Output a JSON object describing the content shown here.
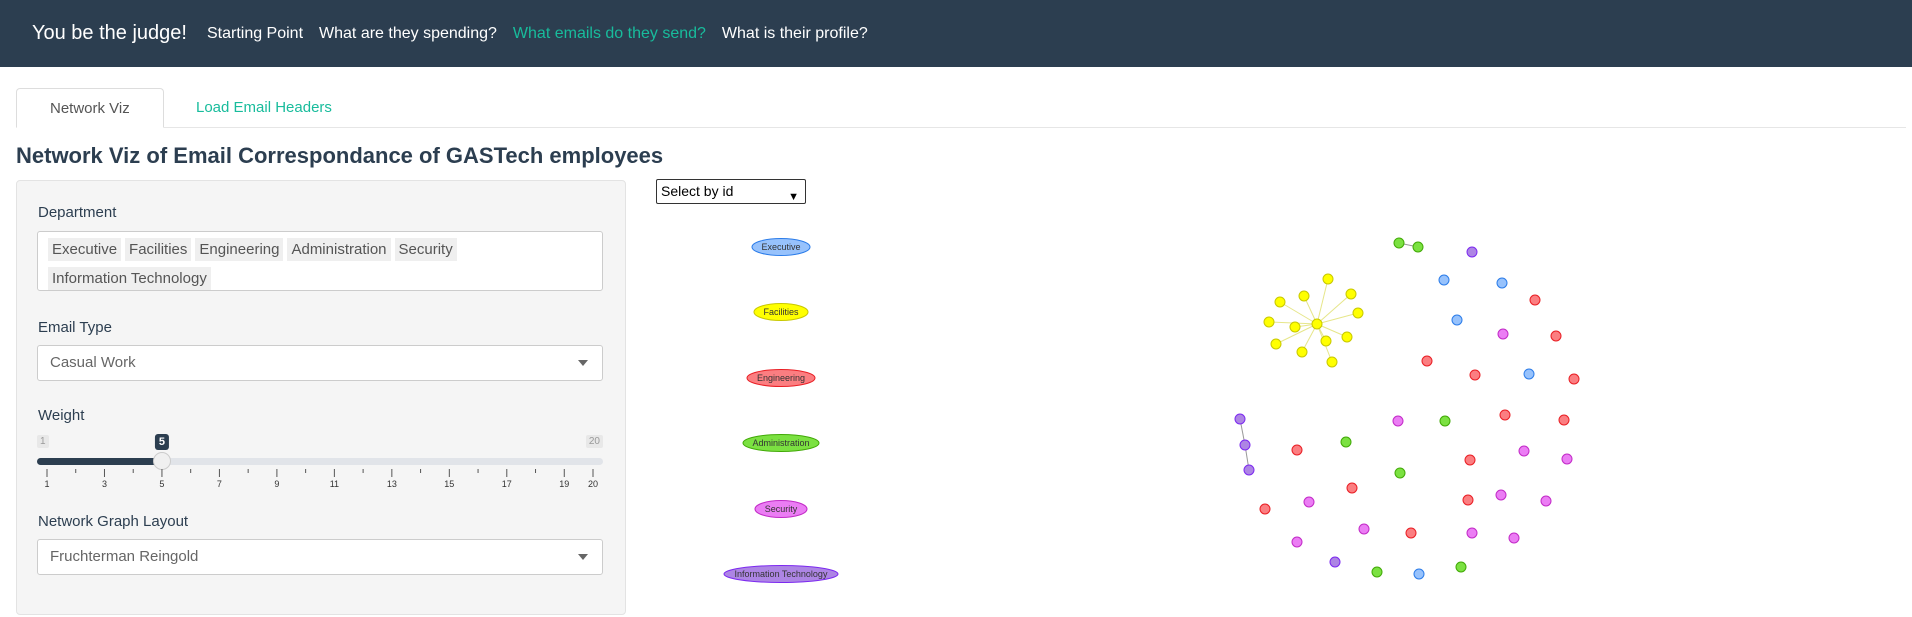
{
  "navbar": {
    "brand": "You be the judge!",
    "items": [
      {
        "label": "Starting Point",
        "active": false
      },
      {
        "label": "What are they spending?",
        "active": false
      },
      {
        "label": "What emails do they send?",
        "active": true
      },
      {
        "label": "What is their profile?",
        "active": false
      }
    ]
  },
  "tabs": [
    "Network Viz",
    "Load Email Headers"
  ],
  "page_title": "Network Viz of Email Correspondance of GASTech employees",
  "filters": {
    "department_label": "Department",
    "departments": [
      "Executive",
      "Facilities",
      "Engineering",
      "Administration",
      "Security",
      "Information Technology"
    ],
    "email_type_label": "Email Type",
    "email_type_value": "Casual Work",
    "weight_label": "Weight",
    "weight_min": "1",
    "weight_max": "20",
    "weight_value": "5",
    "weight_ticks": [
      "1",
      "3",
      "5",
      "7",
      "9",
      "11",
      "13",
      "15",
      "17",
      "19",
      "20"
    ],
    "layout_label": "Network Graph Layout",
    "layout_value": "Fruchterman Reingold"
  },
  "id_select": "Select by id",
  "legend": [
    {
      "label": "Executive",
      "color": "#97c2fc",
      "border": "#2b7ce9"
    },
    {
      "label": "Facilities",
      "color": "#ffff00",
      "border": "#c8c800"
    },
    {
      "label": "Engineering",
      "color": "#fb7e81",
      "border": "#e91e24"
    },
    {
      "label": "Administration",
      "color": "#7be141",
      "border": "#41a906"
    },
    {
      "label": "Security",
      "color": "#eb7df4",
      "border": "#c22ac7"
    },
    {
      "label": "Information Technology",
      "color": "#ad85e4",
      "border": "#7c29f0"
    }
  ]
}
